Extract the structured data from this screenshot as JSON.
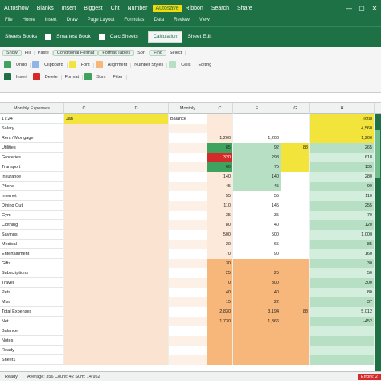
{
  "titlebar": {
    "items": [
      "Autoshow",
      "Blanks",
      "Insert",
      "Biggest",
      "Cht",
      "Number"
    ],
    "highlight": "Autosave",
    "right_items": [
      "Ribbon",
      "Search",
      "Share"
    ],
    "win": [
      "—",
      "▢",
      "✕"
    ]
  },
  "tabs": [
    "File",
    "Home",
    "Insert",
    "Draw",
    "Page Layout",
    "Formulas",
    "Data",
    "Review",
    "View"
  ],
  "ribbon_top": {
    "left": "Sheets Books",
    "mid": "Smartest Book",
    "right": "Calc Sheets",
    "box": "Calculation",
    "right2": "Sheet Edit"
  },
  "ribbon_groups_row1": [
    "Show",
    "Fill",
    "Paste",
    "Conditional Format",
    "Format Tables",
    "Sort",
    "Find",
    "Select"
  ],
  "ribbon_groups_row2": [
    "Undo",
    "Clipboard",
    "Font",
    "Alignment",
    "Number Styles",
    "Cells",
    "Editing"
  ],
  "ribbon_groups_row3": [
    "Insert",
    "Delete",
    "Format",
    "Sum",
    "Filter"
  ],
  "columns": [
    "Monthly Expenses",
    "C",
    "D",
    "Monthly",
    "C",
    "F",
    "G",
    "H"
  ],
  "colors": {
    "green_dark": "#1e7145",
    "green_mid": "#3fa35f",
    "green_light": "#b7dfc3",
    "yellow": "#f2e43a",
    "orange": "#f7b77a",
    "red": "#d42a2a",
    "peach": "#fbe3d2",
    "blue": "#8fb6e6"
  },
  "rows": [
    {
      "a": "17:24",
      "b": "Jan",
      "c": "",
      "d": "Balance",
      "e": "",
      "f": "",
      "g": "",
      "h": "Total"
    },
    {
      "a": "Salary",
      "b": "",
      "c": "",
      "d": "",
      "e": "",
      "f": "",
      "g": "",
      "h": "4,560"
    },
    {
      "a": "Rent / Mortgage",
      "b": "",
      "c": "",
      "d": "",
      "e": "1,200",
      "f": "1,200",
      "g": "",
      "h": "1,200"
    },
    {
      "a": "Utilities",
      "b": "",
      "c": "",
      "d": "",
      "e": "85",
      "f": "92",
      "g": "88",
      "h": "265"
    },
    {
      "a": "Groceries",
      "b": "",
      "c": "",
      "d": "",
      "e": "320",
      "f": "298",
      "g": "",
      "h": "618"
    },
    {
      "a": "Transport",
      "b": "",
      "c": "",
      "d": "",
      "e": "60",
      "f": "75",
      "g": "",
      "h": "135"
    },
    {
      "a": "Insurance",
      "b": "",
      "c": "",
      "d": "",
      "e": "140",
      "f": "140",
      "g": "",
      "h": "280"
    },
    {
      "a": "Phone",
      "b": "",
      "c": "",
      "d": "",
      "e": "45",
      "f": "45",
      "g": "",
      "h": "90"
    },
    {
      "a": "Internet",
      "b": "",
      "c": "",
      "d": "",
      "e": "55",
      "f": "55",
      "g": "",
      "h": "110"
    },
    {
      "a": "Dining Out",
      "b": "",
      "c": "",
      "d": "",
      "e": "110",
      "f": "145",
      "g": "",
      "h": "255"
    },
    {
      "a": "Gym",
      "b": "",
      "c": "",
      "d": "",
      "e": "35",
      "f": "35",
      "g": "",
      "h": "70"
    },
    {
      "a": "Clothing",
      "b": "",
      "c": "",
      "d": "",
      "e": "80",
      "f": "40",
      "g": "",
      "h": "120"
    },
    {
      "a": "Savings",
      "b": "",
      "c": "",
      "d": "",
      "e": "500",
      "f": "500",
      "g": "",
      "h": "1,000"
    },
    {
      "a": "Medical",
      "b": "",
      "c": "",
      "d": "",
      "e": "20",
      "f": "65",
      "g": "",
      "h": "85"
    },
    {
      "a": "Entertainment",
      "b": "",
      "c": "",
      "d": "",
      "e": "70",
      "f": "90",
      "g": "",
      "h": "160"
    },
    {
      "a": "Gifts",
      "b": "",
      "c": "",
      "d": "",
      "e": "30",
      "f": "",
      "g": "",
      "h": "30"
    },
    {
      "a": "Subscriptions",
      "b": "",
      "c": "",
      "d": "",
      "e": "25",
      "f": "25",
      "g": "",
      "h": "50"
    },
    {
      "a": "Travel",
      "b": "",
      "c": "",
      "d": "",
      "e": "0",
      "f": "300",
      "g": "",
      "h": "300"
    },
    {
      "a": "Pets",
      "b": "",
      "c": "",
      "d": "",
      "e": "40",
      "f": "40",
      "g": "",
      "h": "80"
    },
    {
      "a": "Misc",
      "b": "",
      "c": "",
      "d": "",
      "e": "15",
      "f": "22",
      "g": "",
      "h": "37"
    },
    {
      "a": "Total Expenses",
      "b": "",
      "c": "",
      "d": "",
      "e": "2,830",
      "f": "3,194",
      "g": "88",
      "h": "5,012"
    },
    {
      "a": "Net",
      "b": "",
      "c": "",
      "d": "",
      "e": "1,730",
      "f": "1,366",
      "g": "",
      "h": "-452"
    },
    {
      "a": "Balance",
      "b": "",
      "c": "",
      "d": "",
      "e": "",
      "f": "",
      "g": "",
      "h": ""
    },
    {
      "a": "Notes",
      "b": "",
      "c": "",
      "d": "",
      "e": "",
      "f": "",
      "g": "",
      "h": ""
    },
    {
      "a": "Ready",
      "b": "",
      "c": "",
      "d": "",
      "e": "",
      "f": "",
      "g": "",
      "h": ""
    },
    {
      "a": "Sheet1",
      "b": "",
      "c": "",
      "d": "",
      "e": "",
      "f": "",
      "g": "",
      "h": ""
    }
  ],
  "statusbar": {
    "left": "Ready",
    "mid": "Average: 356  Count: 42  Sum: 14,952",
    "right": "Errors: 2"
  }
}
